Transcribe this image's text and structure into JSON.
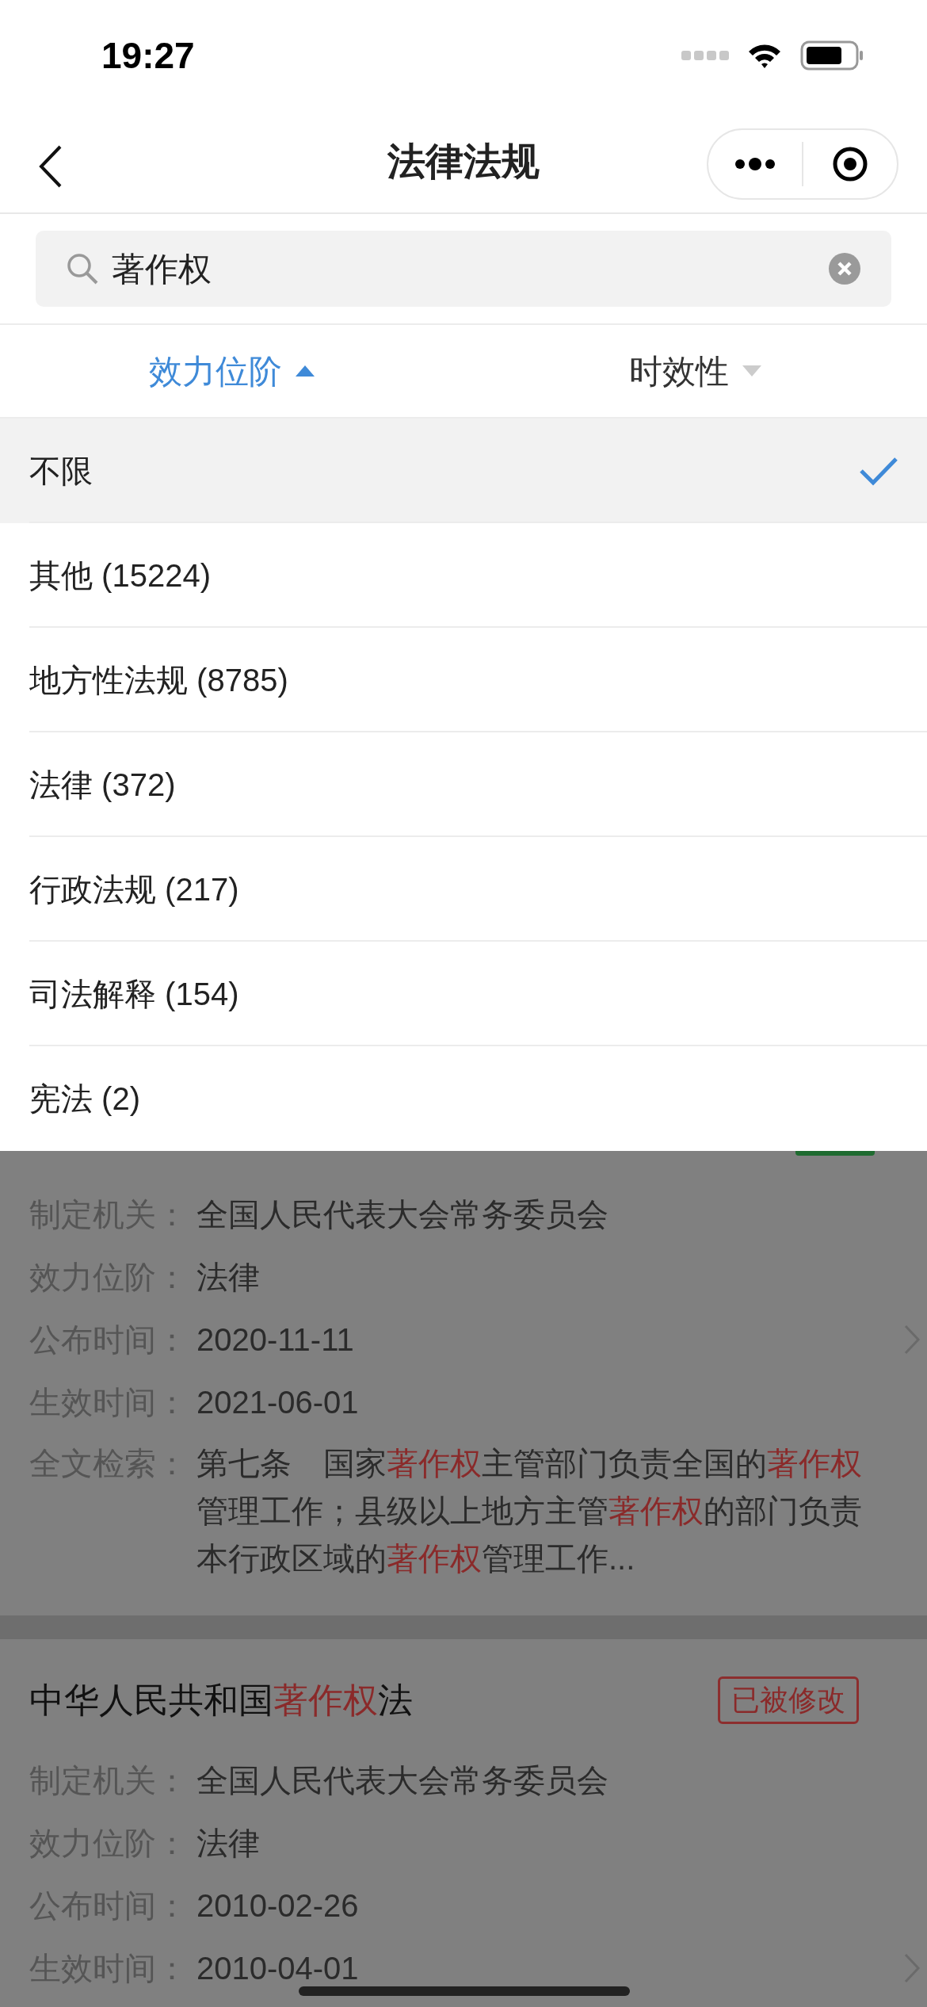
{
  "status_bar": {
    "time": "19:27"
  },
  "nav": {
    "title": "法律法规"
  },
  "search": {
    "value": "著作权"
  },
  "filters": [
    {
      "label": "效力位阶",
      "selected": true,
      "expanded": true
    },
    {
      "label": "时效性",
      "selected": false,
      "expanded": false
    }
  ],
  "dropdown": {
    "options": [
      {
        "label": "不限",
        "selected": true
      },
      {
        "label": "其他 (15224)",
        "selected": false
      },
      {
        "label": "地方性法规 (8785)",
        "selected": false
      },
      {
        "label": "法律 (372)",
        "selected": false
      },
      {
        "label": "行政法规 (217)",
        "selected": false
      },
      {
        "label": "司法解释 (154)",
        "selected": false
      },
      {
        "label": "宪法 (2)",
        "selected": false
      }
    ]
  },
  "results": [
    {
      "tag": {
        "kind": "current"
      },
      "fields": [
        {
          "label": "制定机关：",
          "value": [
            {
              "text": "全国人民代表大会常务委员会",
              "highlight": false
            }
          ]
        },
        {
          "label": "效力位阶：",
          "value": [
            {
              "text": "法律",
              "highlight": false
            }
          ]
        },
        {
          "label": "公布时间：",
          "value": [
            {
              "text": "2020-11-11",
              "highlight": false
            }
          ]
        },
        {
          "label": "生效时间：",
          "value": [
            {
              "text": "2021-06-01",
              "highlight": false
            }
          ]
        },
        {
          "label": "全文检索：",
          "value": [
            {
              "text": "第七条　国家",
              "highlight": false
            },
            {
              "text": "著作权",
              "highlight": true
            },
            {
              "text": "主管部门负责全国的",
              "highlight": false
            },
            {
              "text": "著作权",
              "highlight": true
            },
            {
              "text": "管理工作；县级以上地方主管",
              "highlight": false
            },
            {
              "text": "著作权",
              "highlight": true
            },
            {
              "text": "的部门负责本行政区域的",
              "highlight": false
            },
            {
              "text": "著作权",
              "highlight": true
            },
            {
              "text": "管理工作...",
              "highlight": false
            }
          ]
        }
      ]
    },
    {
      "title": [
        {
          "text": "中华人民共和国",
          "highlight": false
        },
        {
          "text": "著作权",
          "highlight": true
        },
        {
          "text": "法",
          "highlight": false
        }
      ],
      "tag": {
        "kind": "amended",
        "label": "已被修改"
      },
      "fields": [
        {
          "label": "制定机关：",
          "value": [
            {
              "text": "全国人民代表大会常务委员会",
              "highlight": false
            }
          ]
        },
        {
          "label": "效力位阶：",
          "value": [
            {
              "text": "法律",
              "highlight": false
            }
          ]
        },
        {
          "label": "公布时间：",
          "value": [
            {
              "text": "2010-02-26",
              "highlight": false
            }
          ]
        },
        {
          "label": "生效时间：",
          "value": [
            {
              "text": "2010-04-01",
              "highlight": false
            }
          ]
        }
      ]
    }
  ]
}
